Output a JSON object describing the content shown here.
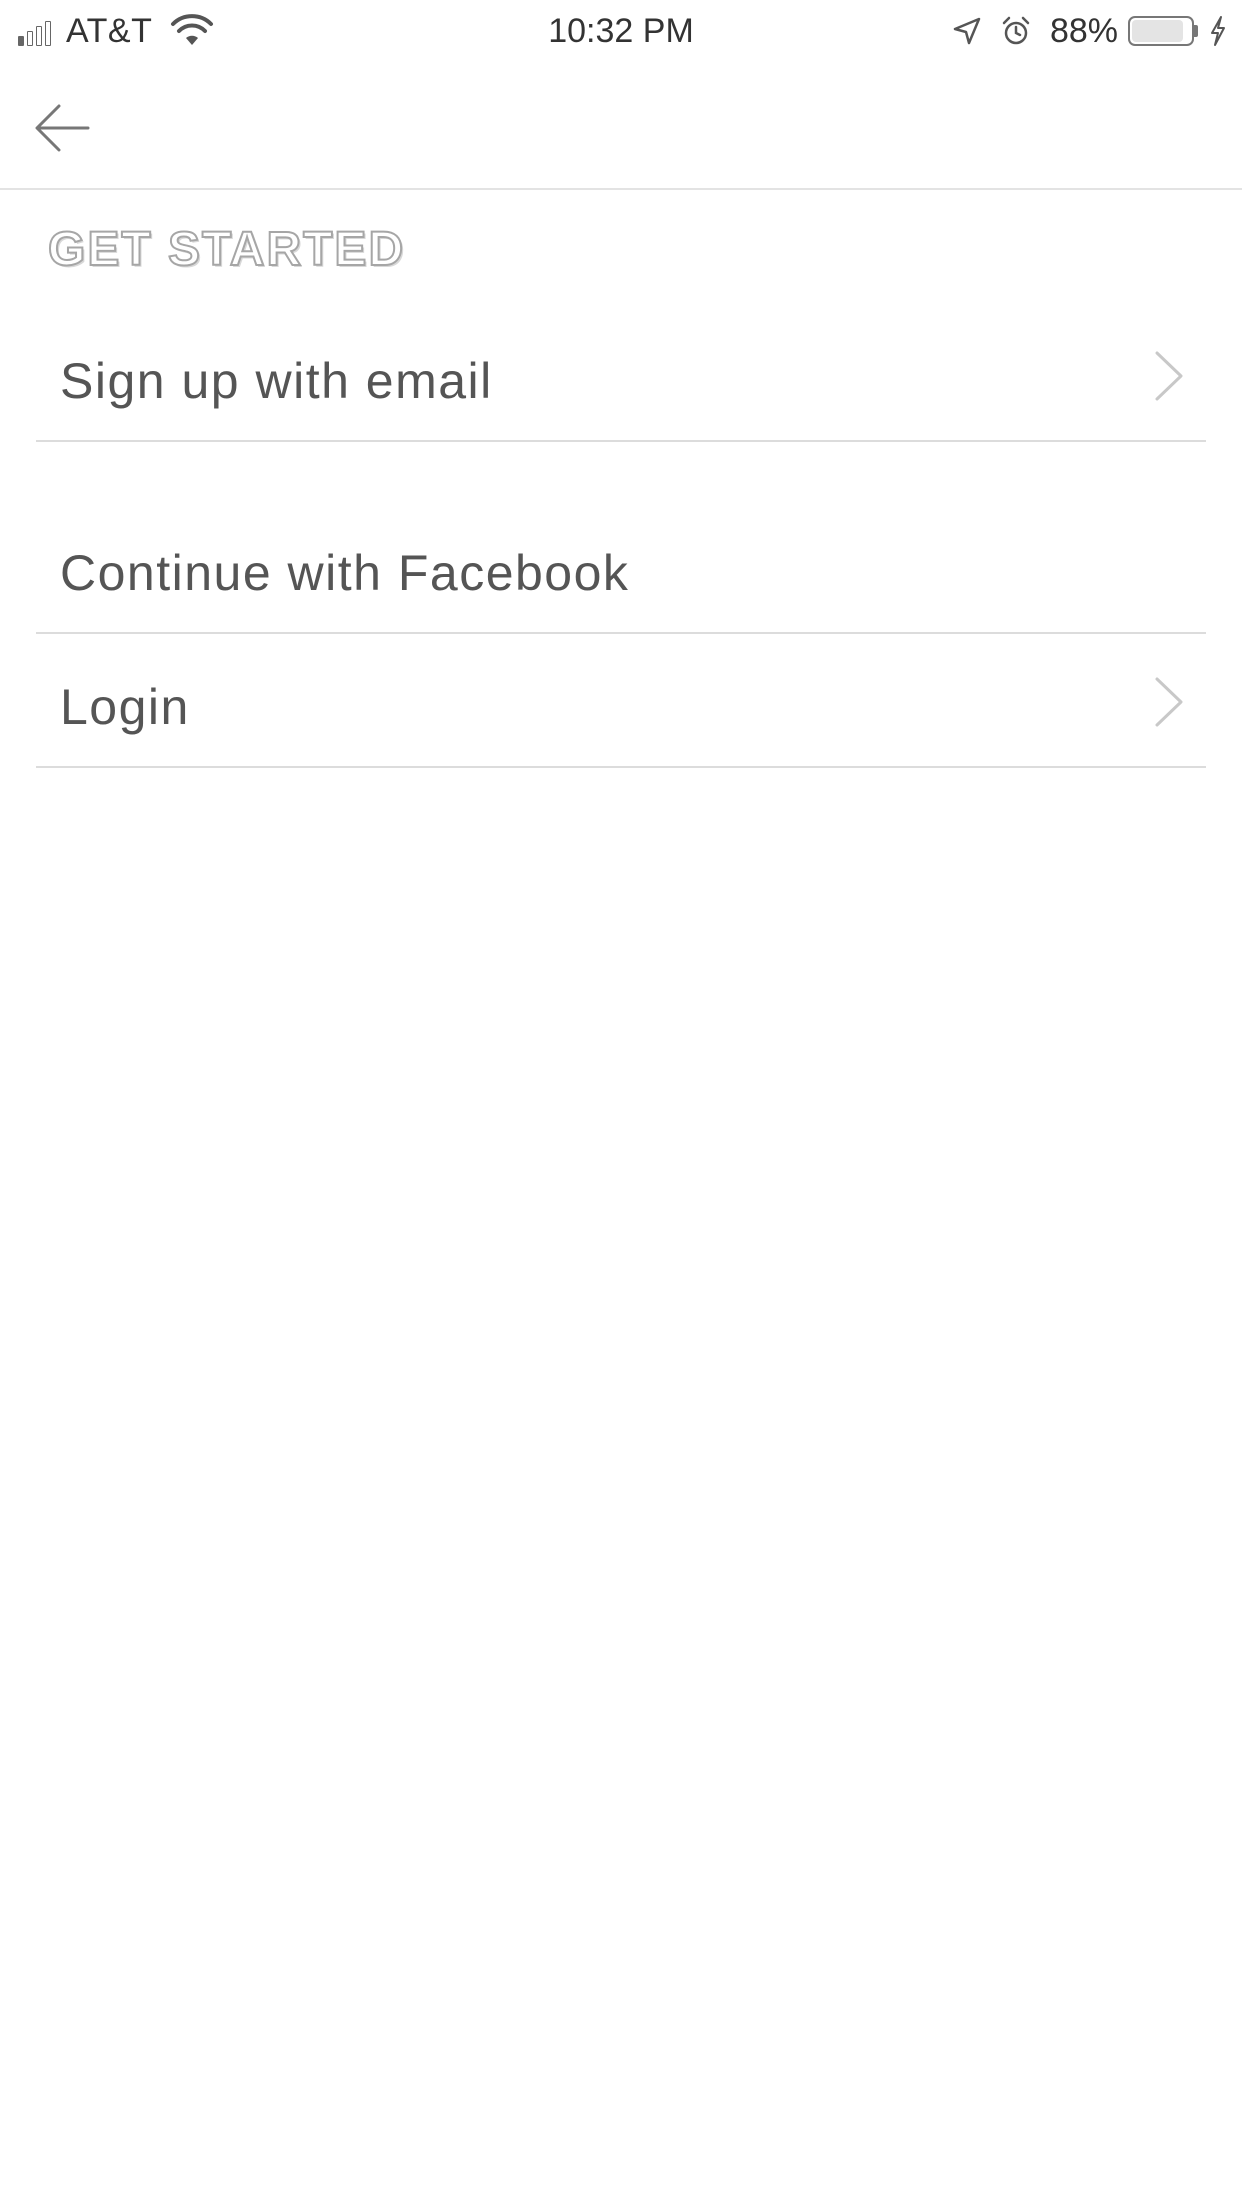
{
  "status_bar": {
    "carrier": "AT&T",
    "time": "10:32 PM",
    "battery_percent": "88%",
    "battery_level": 0.88,
    "signal_bars_filled": 1,
    "signal_bars_total": 4,
    "charging": true
  },
  "nav": {
    "back_icon": "arrow-left-icon"
  },
  "main": {
    "section_title": "GET STARTED",
    "options": [
      {
        "label": "Sign up with email",
        "chevron": true
      },
      {
        "label": "Continue with Facebook",
        "chevron": false
      },
      {
        "label": "Login",
        "chevron": true
      }
    ]
  },
  "colors": {
    "text": "#555555",
    "divider": "#dcdcdc",
    "chevron": "#c8c8c8",
    "background": "#ffffff"
  }
}
